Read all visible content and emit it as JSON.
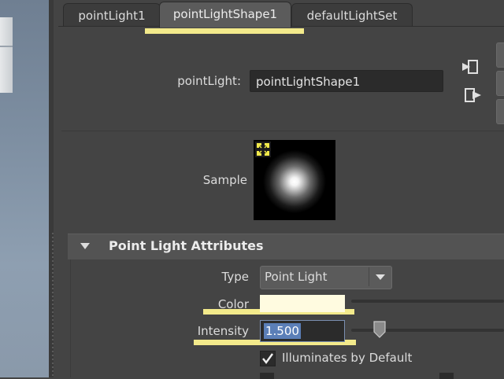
{
  "tabs": [
    {
      "label": "pointLight1",
      "active": false
    },
    {
      "label": "pointLightShape1",
      "active": true
    },
    {
      "label": "defaultLightSet",
      "active": false
    }
  ],
  "node": {
    "label": "pointLight:",
    "value": "pointLightShape1"
  },
  "sample": {
    "label": "Sample",
    "update_icon": "arrows-converge-icon"
  },
  "section": {
    "title": "Point Light Attributes",
    "expanded": true
  },
  "attributes": {
    "type_label": "Type",
    "type_value": "Point Light",
    "color_label": "Color",
    "color_value": "#fffbe0",
    "intensity_label": "Intensity",
    "intensity_value": "1.500",
    "illuminates_label": "Illuminates by Default",
    "illuminates_checked": true
  },
  "colors": {
    "highlight": "#f3ea8b",
    "panel_bg": "#444444",
    "selection": "#5b7fb8"
  }
}
